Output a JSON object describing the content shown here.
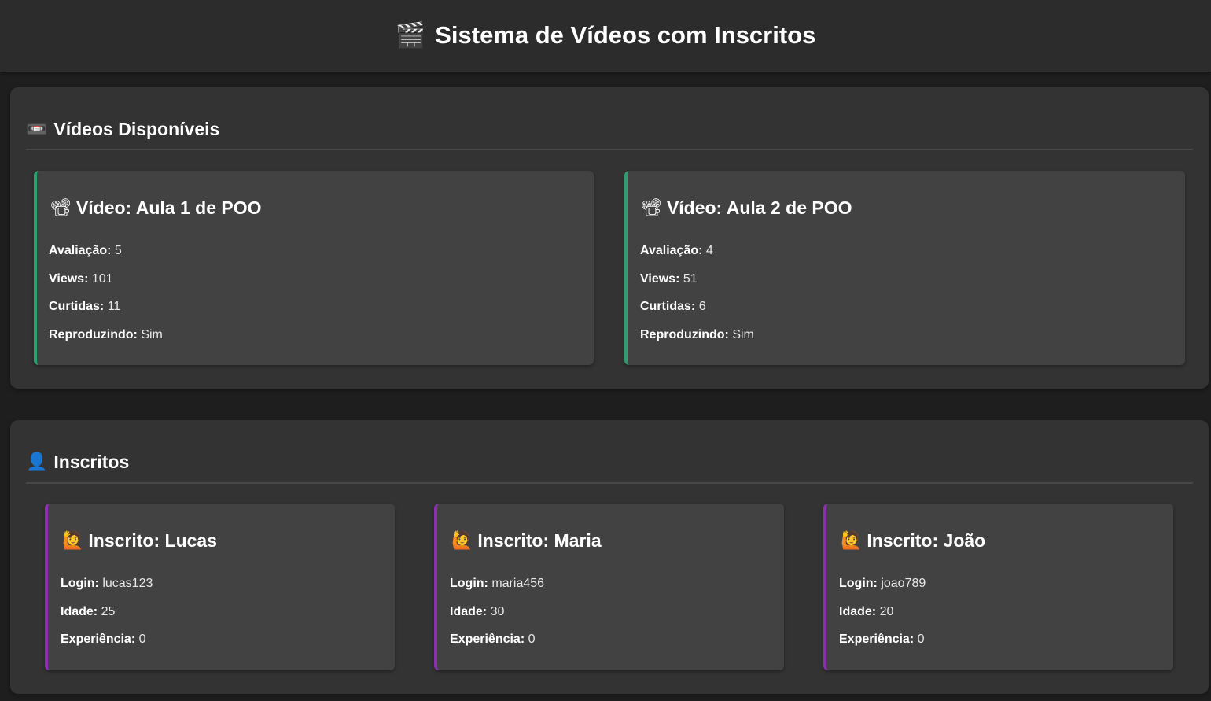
{
  "header": {
    "icon": "🎬",
    "title": "Sistema de Vídeos com Inscritos"
  },
  "videos_section": {
    "icon": "📼",
    "title": "Vídeos Disponíveis",
    "cards": [
      {
        "icon": "📽",
        "title": "Vídeo: Aula 1 de POO",
        "fields": [
          {
            "label": "Avaliação:",
            "value": "5"
          },
          {
            "label": "Views:",
            "value": "101"
          },
          {
            "label": "Curtidas:",
            "value": "11"
          },
          {
            "label": "Reproduzindo:",
            "value": "Sim"
          }
        ]
      },
      {
        "icon": "📽",
        "title": "Vídeo: Aula 2 de POO",
        "fields": [
          {
            "label": "Avaliação:",
            "value": "4"
          },
          {
            "label": "Views:",
            "value": "51"
          },
          {
            "label": "Curtidas:",
            "value": "6"
          },
          {
            "label": "Reproduzindo:",
            "value": "Sim"
          }
        ]
      }
    ]
  },
  "subscribers_section": {
    "icon": "👤",
    "title": "Inscritos",
    "cards": [
      {
        "icon": "🙋",
        "title": "Inscrito: Lucas",
        "fields": [
          {
            "label": "Login:",
            "value": "lucas123"
          },
          {
            "label": "Idade:",
            "value": "25"
          },
          {
            "label": "Experiência:",
            "value": "0"
          }
        ]
      },
      {
        "icon": "🙋",
        "title": "Inscrito: Maria",
        "fields": [
          {
            "label": "Login:",
            "value": "maria456"
          },
          {
            "label": "Idade:",
            "value": "30"
          },
          {
            "label": "Experiência:",
            "value": "0"
          }
        ]
      },
      {
        "icon": "🙋",
        "title": "Inscrito: João",
        "fields": [
          {
            "label": "Login:",
            "value": "joao789"
          },
          {
            "label": "Idade:",
            "value": "20"
          },
          {
            "label": "Experiência:",
            "value": "0"
          }
        ]
      }
    ]
  },
  "colors": {
    "background": "#1e1e1e",
    "header": "#2c2c2c",
    "panel": "#333333",
    "card": "#424242",
    "video_accent": "#2e9e6e",
    "subscriber_accent": "#8a2fb0"
  }
}
